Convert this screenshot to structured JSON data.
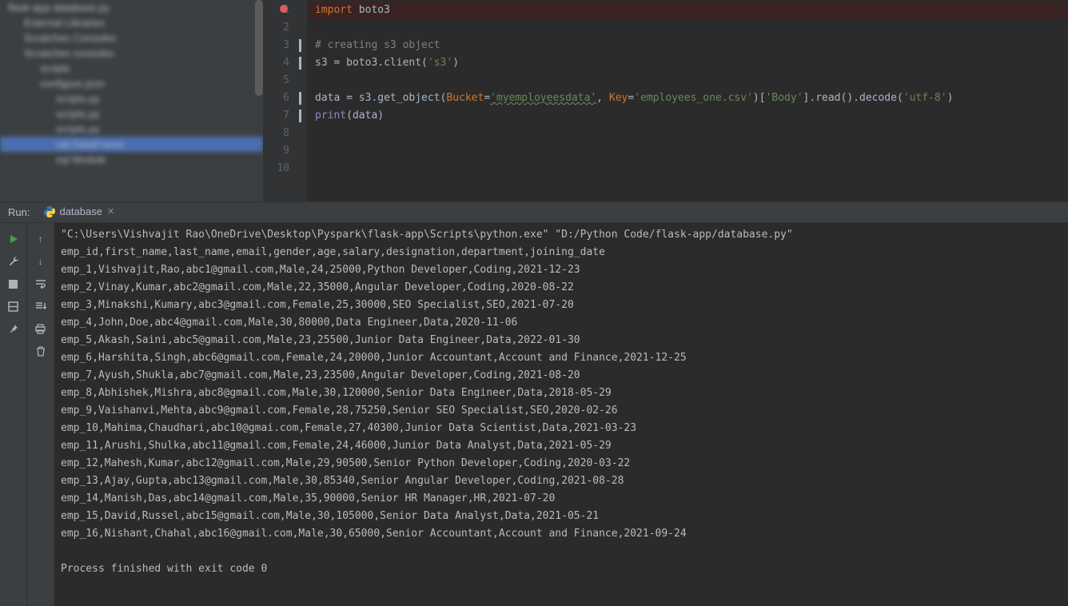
{
  "sidebar": {
    "items": [
      {
        "indent": 0,
        "label": "flask-app database.py",
        "sel": false
      },
      {
        "indent": 1,
        "label": "External Libraries",
        "sel": false
      },
      {
        "indent": 1,
        "label": "Scratches Consoles",
        "sel": false
      },
      {
        "indent": 1,
        "label": "Scratches consoles",
        "sel": false
      },
      {
        "indent": 2,
        "label": "scripts",
        "sel": false
      },
      {
        "indent": 2,
        "label": "configure.json",
        "sel": false
      },
      {
        "indent": 3,
        "label": "scripts.py",
        "sel": false
      },
      {
        "indent": 3,
        "label": "scripts.py",
        "sel": false
      },
      {
        "indent": 3,
        "label": "scripts.py",
        "sel": false
      },
      {
        "indent": 3,
        "label": "sql DataFrame",
        "sel": true
      },
      {
        "indent": 3,
        "label": "sql Module",
        "sel": false
      }
    ]
  },
  "editor": {
    "lines": [
      "1",
      "2",
      "3",
      "4",
      "5",
      "6",
      "7",
      "8",
      "9",
      "10"
    ],
    "code": {
      "l1_import": "import",
      "l1_mod": " boto3",
      "l3": "# creating s3 object",
      "l4_a": "s3 = boto3.client(",
      "l4_s": "'s3'",
      "l4_b": ")",
      "l6_a": "data = s3.get_object(",
      "l6_k1": "Bucket",
      "l6_eq": "=",
      "l6_s1": "'myemployeesdata'",
      "l6_c": ", ",
      "l6_k2": "Key",
      "l6_s2": "'employees_one.csv'",
      "l6_b": ")[",
      "l6_s3": "'Body'",
      "l6_d": "].read().decode(",
      "l6_s4": "'utf-8'",
      "l6_e": ")",
      "l7_a": "print",
      "l7_b": "(data)"
    }
  },
  "run": {
    "label": "Run:",
    "tab": "database",
    "lines": [
      "\"C:\\Users\\Vishvajit Rao\\OneDrive\\Desktop\\Pyspark\\flask-app\\Scripts\\python.exe\" \"D:/Python Code/flask-app/database.py\"",
      "emp_id,first_name,last_name,email,gender,age,salary,designation,department,joining_date",
      "emp_1,Vishvajit,Rao,abc1@gmail.com,Male,24,25000,Python Developer,Coding,2021-12-23",
      "emp_2,Vinay,Kumar,abc2@gmail.com,Male,22,35000,Angular Developer,Coding,2020-08-22",
      "emp_3,Minakshi,Kumary,abc3@gmail.com,Female,25,30000,SEO Specialist,SEO,2021-07-20",
      "emp_4,John,Doe,abc4@gmail.com,Male,30,80000,Data Engineer,Data,2020-11-06",
      "emp_5,Akash,Saini,abc5@gmail.com,Male,23,25500,Junior Data Engineer,Data,2022-01-30",
      "emp_6,Harshita,Singh,abc6@gmail.com,Female,24,20000,Junior Accountant,Account and Finance,2021-12-25",
      "emp_7,Ayush,Shukla,abc7@gmail.com,Male,23,23500,Angular Developer,Coding,2021-08-20",
      "emp_8,Abhishek,Mishra,abc8@gmail.com,Male,30,120000,Senior Data Engineer,Data,2018-05-29",
      "emp_9,Vaishanvi,Mehta,abc9@gmail.com,Female,28,75250,Senior SEO Specialist,SEO,2020-02-26",
      "emp_10,Mahima,Chaudhari,abc10@gmai.com,Female,27,40300,Junior Data Scientist,Data,2021-03-23",
      "emp_11,Arushi,Shulka,abc11@gmail.com,Female,24,46000,Junior Data Analyst,Data,2021-05-29",
      "emp_12,Mahesh,Kumar,abc12@gmail.com,Male,29,90500,Senior Python Developer,Coding,2020-03-22",
      "emp_13,Ajay,Gupta,abc13@gmail.com,Male,30,85340,Senior Angular Developer,Coding,2021-08-28",
      "emp_14,Manish,Das,abc14@gmail.com,Male,35,90000,Senior HR Manager,HR,2021-07-20",
      "emp_15,David,Russel,abc15@gmail.com,Male,30,105000,Senior Data Analyst,Data,2021-05-21",
      "emp_16,Nishant,Chahal,abc16@gmail.com,Male,30,65000,Senior Accountant,Account and Finance,2021-09-24",
      "",
      "Process finished with exit code 0"
    ]
  }
}
